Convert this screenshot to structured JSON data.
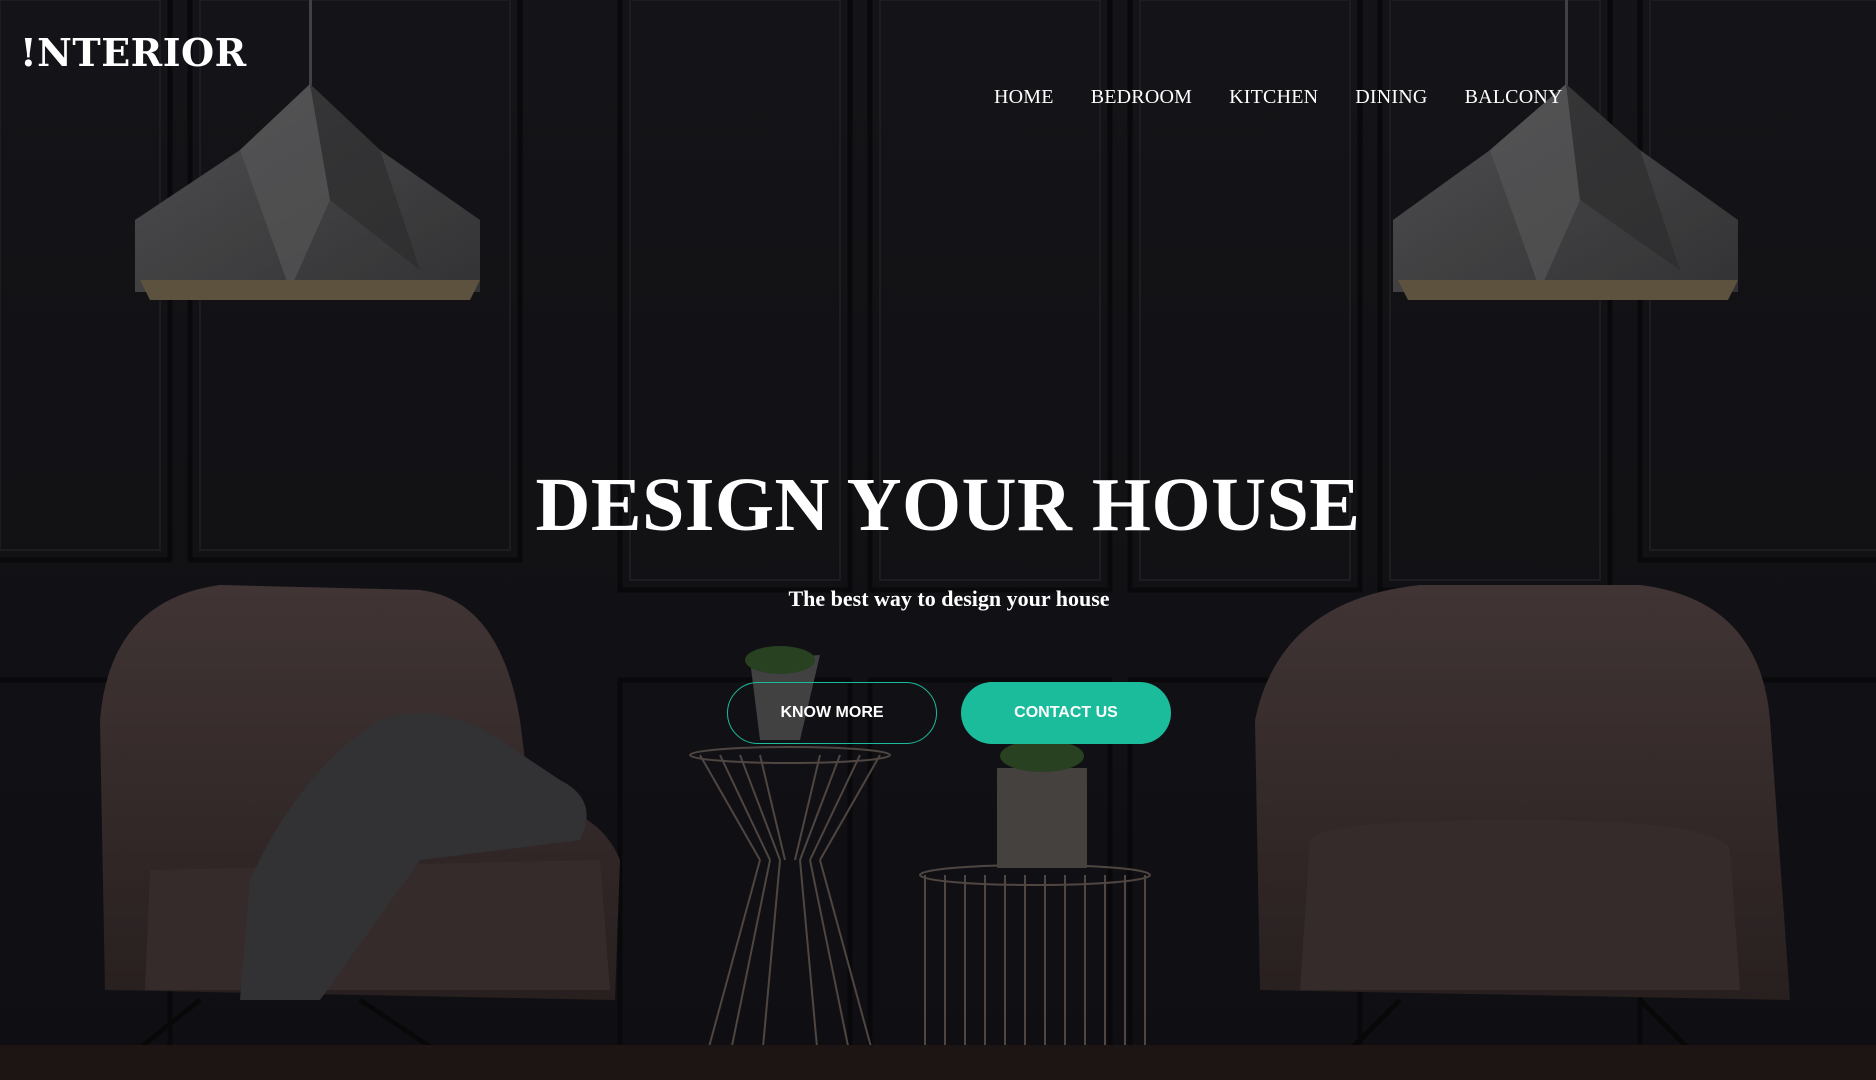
{
  "brand": {
    "logo_text": "!NTERIOR"
  },
  "nav": {
    "items": [
      "HOME",
      "BEDROOM",
      "KITCHEN",
      "DINING",
      "BALCONY"
    ]
  },
  "hero": {
    "title": "DESIGN YOUR HOUSE",
    "subtitle": "The best way to design your house",
    "primary_button": "KNOW MORE",
    "secondary_button": "CONTACT US"
  },
  "colors": {
    "accent": "#1abc9c",
    "text": "#ffffff",
    "background": "#141418"
  }
}
